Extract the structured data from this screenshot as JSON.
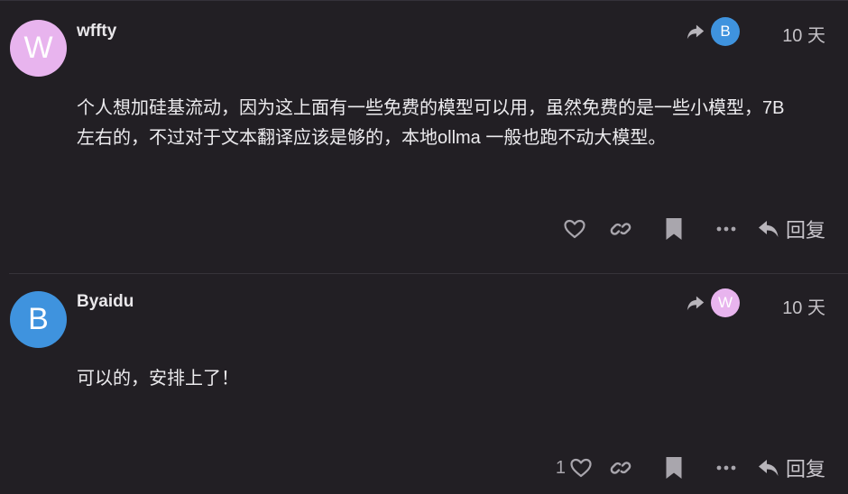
{
  "posts": [
    {
      "username": "wffty",
      "avatar_letter": "W",
      "avatar_color": "#e8b4ee",
      "reply_to_letter": "B",
      "reply_to_color": "#3f93de",
      "time": "10 天",
      "body_lines": [
        "个人想加硅基流动，因为这上面有一些免费的模型可以用，虽然免费的是一些小模型，7B",
        "左右的，不过对于文本翻译应该是够的，本地ollma 一般也跑不动大模型。"
      ],
      "like_count": "",
      "reply_label": "回复"
    },
    {
      "username": "Byaidu",
      "avatar_letter": "B",
      "avatar_color": "#3f93de",
      "reply_to_letter": "W",
      "reply_to_color": "#e8b4ee",
      "time": "10 天",
      "body_lines": [
        "可以的，安排上了！"
      ],
      "like_count": "1",
      "reply_label": "回复"
    }
  ],
  "icons": {
    "reply_to": "share-arrow-icon",
    "like": "heart-icon",
    "link": "link-icon",
    "bookmark": "bookmark-icon",
    "more": "ellipsis-icon",
    "reply": "reply-arrow-icon"
  },
  "colors": {
    "background": "#221f24",
    "icon": "#a9a6ad",
    "text": "#ecebee"
  }
}
